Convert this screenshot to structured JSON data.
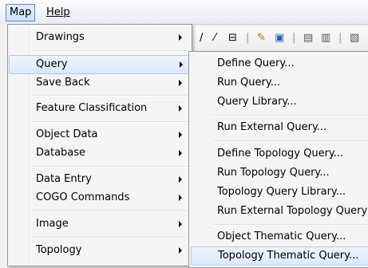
{
  "menubar": {
    "map_label": "Map",
    "help_label": "Help"
  },
  "toolbar_glyphs": [
    "/",
    "⁄",
    "⊟",
    "|",
    "✎",
    "▣",
    "|",
    "▤",
    "▥",
    "|",
    "▧"
  ],
  "menu": {
    "items": [
      {
        "label": "Drawings"
      },
      {
        "label": "Query"
      },
      {
        "label": "Save Back"
      },
      {
        "label": "Feature Classification"
      },
      {
        "label": "Object Data"
      },
      {
        "label": "Database"
      },
      {
        "label": "Data Entry"
      },
      {
        "label": "COGO Commands"
      },
      {
        "label": "Image"
      },
      {
        "label": "Topology"
      }
    ]
  },
  "submenu": {
    "items": [
      {
        "label": "Define Query..."
      },
      {
        "label": "Run Query..."
      },
      {
        "label": "Query Library..."
      },
      {
        "label": "Run External Query..."
      },
      {
        "label": "Define Topology Query..."
      },
      {
        "label": "Run Topology Query..."
      },
      {
        "label": "Topology Query Library..."
      },
      {
        "label": "Run External Topology Query"
      },
      {
        "label": "Object Thematic Query..."
      },
      {
        "label": "Topology Thematic Query..."
      }
    ]
  }
}
